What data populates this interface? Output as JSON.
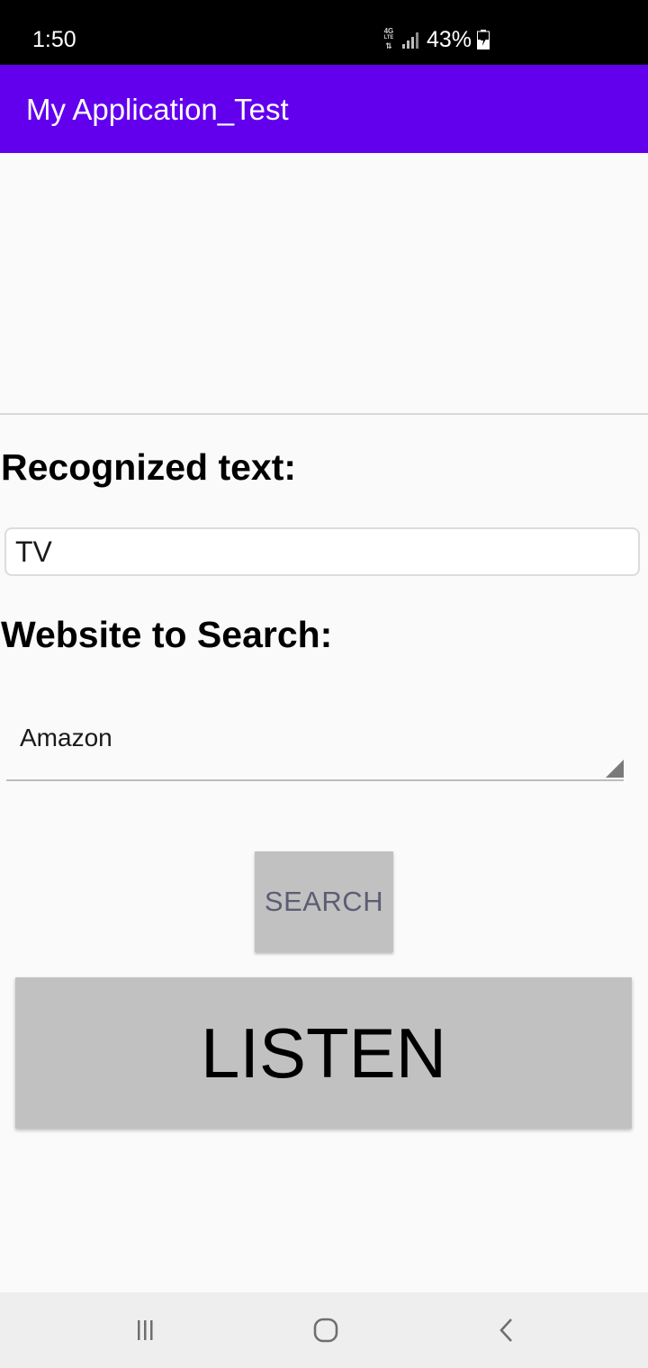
{
  "status_bar": {
    "time": "1:50",
    "network_label": "4G",
    "network_sub": "LTE",
    "battery_percent": "43%",
    "icons": [
      "lte-icon",
      "signal-icon",
      "battery-charging-icon"
    ]
  },
  "app_bar": {
    "title": "My Application_Test",
    "color": "#6200ee"
  },
  "main": {
    "recognized_heading": "Recognized text:",
    "recognized_value": "TV",
    "website_heading": "Website to Search:",
    "website_selected": "Amazon",
    "search_label": "SEARCH",
    "listen_label": "LISTEN"
  },
  "nav_bar": {
    "icons": [
      "recents-icon",
      "home-icon",
      "back-icon"
    ]
  },
  "colors": {
    "button_bg": "#c1c1c1",
    "search_text": "#5b5e73",
    "background": "#fafafa"
  }
}
